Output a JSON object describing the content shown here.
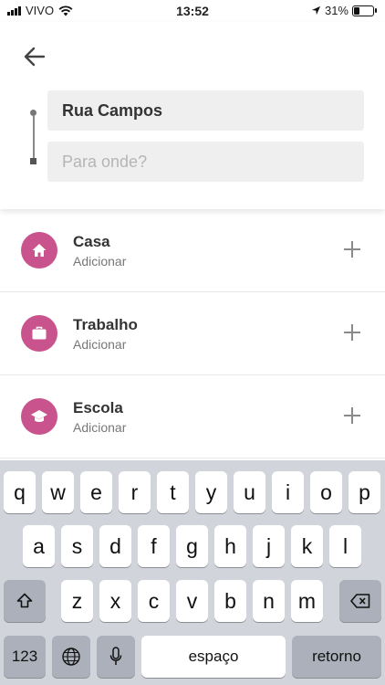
{
  "status": {
    "carrier": "VIVO",
    "time": "13:52",
    "battery": "31%"
  },
  "header": {
    "from_value": "Rua Campos",
    "to_placeholder": "Para onde?"
  },
  "places": [
    {
      "name": "Casa",
      "action": "Adicionar",
      "icon": "home-icon"
    },
    {
      "name": "Trabalho",
      "action": "Adicionar",
      "icon": "briefcase-icon"
    },
    {
      "name": "Escola",
      "action": "Adicionar",
      "icon": "graduation-cap-icon"
    }
  ],
  "colors": {
    "accent": "#c9538d"
  },
  "keyboard": {
    "row1": [
      "q",
      "w",
      "e",
      "r",
      "t",
      "y",
      "u",
      "i",
      "o",
      "p"
    ],
    "row2": [
      "a",
      "s",
      "d",
      "f",
      "g",
      "h",
      "j",
      "k",
      "l"
    ],
    "row3": [
      "z",
      "x",
      "c",
      "v",
      "b",
      "n",
      "m"
    ],
    "numbers_label": "123",
    "space_label": "espaço",
    "return_label": "retorno"
  }
}
